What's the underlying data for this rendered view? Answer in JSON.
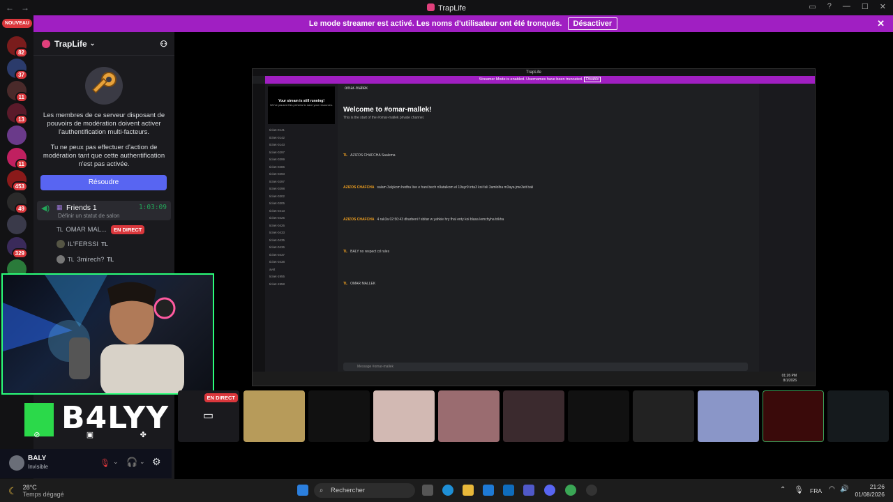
{
  "window": {
    "title": "TrapLife",
    "back": "←",
    "forward": "→",
    "minimize": "—",
    "maximize": "☐",
    "close": "✕"
  },
  "banner": {
    "text": "Le mode streamer est activé. Les noms d'utilisateur ont été tronqués.",
    "button": "Désactiver"
  },
  "guilds": {
    "new_label": "NOUVEAU",
    "items": [
      {
        "badge": "82",
        "color": "#7a1c1c"
      },
      {
        "badge": "37",
        "color": "#2b3b6b"
      },
      {
        "badge": "11",
        "color": "#4a2a2a"
      },
      {
        "badge": "13",
        "color": "#5a1a2a"
      },
      {
        "badge": "",
        "color": "#6a3a8a"
      },
      {
        "badge": "11",
        "color": "#c02060"
      },
      {
        "badge": "453",
        "color": "#8a1a1a"
      },
      {
        "badge": "49",
        "color": "#2a2a2a"
      },
      {
        "badge": "",
        "color": "#3a3a4a"
      },
      {
        "badge": "329",
        "color": "#3a2a5a"
      },
      {
        "badge": "",
        "color": "#2a7a3a"
      }
    ]
  },
  "sidebar": {
    "server_name": "TrapLife",
    "mfa_text_1": "Les membres de ce serveur disposant de pouvoirs de modération doivent activer l'authentification multi-facteurs.",
    "mfa_text_2": "Tu ne peux pas effectuer d'action de modération tant que cette authentification n'est pas activée.",
    "resolve_button": "Résoudre",
    "voice_channel": {
      "name": "Friends 1",
      "timer": "1:03:09",
      "status": "Définir un statut de salon"
    },
    "voice_users": [
      {
        "prefix": "TL",
        "name": "OMAR MAL...",
        "live": "EN DIRECT"
      },
      {
        "prefix": "",
        "name": "IL'FERSSI",
        "tag": "TL"
      },
      {
        "prefix": "TL",
        "name": "3mirech?",
        "tag": "TL"
      }
    ]
  },
  "webcam": {
    "overlay_text": "B4LYY"
  },
  "user": {
    "name": "BALY",
    "status": "Invisible"
  },
  "stream": {
    "live_label": "EN DIRECT",
    "inner_title": "TrapLife",
    "inner_banner": "Streamer Mode is enabled. Usernames have been truncated.",
    "inner_banner_btn": "Disable",
    "channel": "omar-mallek",
    "welcome": "Welcome to #omar-mallek!",
    "welcome_sub": "This is the start of the #omar-mallek private channel.",
    "inner_stream_title": "Your stream is still running!",
    "inner_stream_sub": "We've paused this preview to save your resources.",
    "tickets": [
      "ticket-0141",
      "ticket-0142",
      "ticket-0143",
      "ticket-0297",
      "ticket-0399",
      "ticket-0286",
      "ticket-0293",
      "ticket-0297",
      "ticket-0298",
      "ticket-0302",
      "ticket-0305",
      "ticket-0413",
      "ticket-0425",
      "ticket-0426",
      "ticket-0433",
      "ticket-0435",
      "ticket-0436",
      "ticket-0437",
      "ticket-0438",
      "avst",
      "ticket-1955",
      "ticket-1958"
    ],
    "messages": [
      {
        "user": "TL",
        "text": "AZIZOS CHAFCHA Saalema"
      },
      {
        "user": "AZIZOS CHAFCHA",
        "text": "salam 3alykom hedha live e hani bech n9atalkom el 19ayr9 inta3 koi fali 3amlolha m3aya jme3eit bali"
      },
      {
        "user": "AZIZOS CHAFCHA",
        "text": "4 rak3a 02:50:43 dharbeni f sbitar w yahkie hry fhal enty koi blasa lemchyha trikha"
      },
      {
        "user": "TL",
        "text": "BALY no respect cd rules"
      },
      {
        "user": "TL",
        "text": "OMAR MALLEK"
      }
    ],
    "input_placeholder": "Message #omar-mallek",
    "inner_user": "OMAR MALLEK",
    "inner_time": "01:26 PM",
    "inner_date": "8/1/2026"
  },
  "taskbar": {
    "weather_temp": "28°C",
    "weather_desc": "Temps dégagé",
    "search": "Rechercher",
    "lang": "FRA",
    "time": "21:26",
    "date": "01/08/2026"
  }
}
